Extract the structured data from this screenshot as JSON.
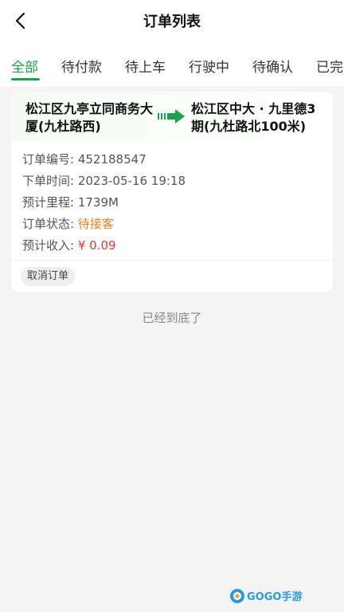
{
  "header": {
    "title": "订单列表",
    "back_icon": "chevron-left-icon"
  },
  "tabs": [
    {
      "label": "全部",
      "active": true
    },
    {
      "label": "待付款",
      "active": false
    },
    {
      "label": "待上车",
      "active": false
    },
    {
      "label": "行驶中",
      "active": false
    },
    {
      "label": "待确认",
      "active": false
    },
    {
      "label": "已完",
      "active": false
    }
  ],
  "order": {
    "route_from": "松江区九亭立同商务大厦(九杜路西)",
    "route_to": "松江区中大 · 九里德3期(九杜路北100米)",
    "arrow_icon": "arrow-right-icon",
    "fields": [
      {
        "label": "订单编号:",
        "value": "452188547"
      },
      {
        "label": "下单时间:",
        "value": "2023-05-16 19:18"
      },
      {
        "label": "预计里程:",
        "value": "1739M"
      },
      {
        "label": "订单状态:",
        "value": "待接客"
      },
      {
        "label": "预计收入:",
        "value": "¥ 0.09"
      }
    ],
    "cancel_label": "取消订单"
  },
  "end_text": "已经到底了",
  "colors": {
    "accent": "#1aa34a",
    "status": "#f08020",
    "income": "#e53935"
  },
  "watermark": {
    "text": "GOGO手游网"
  }
}
